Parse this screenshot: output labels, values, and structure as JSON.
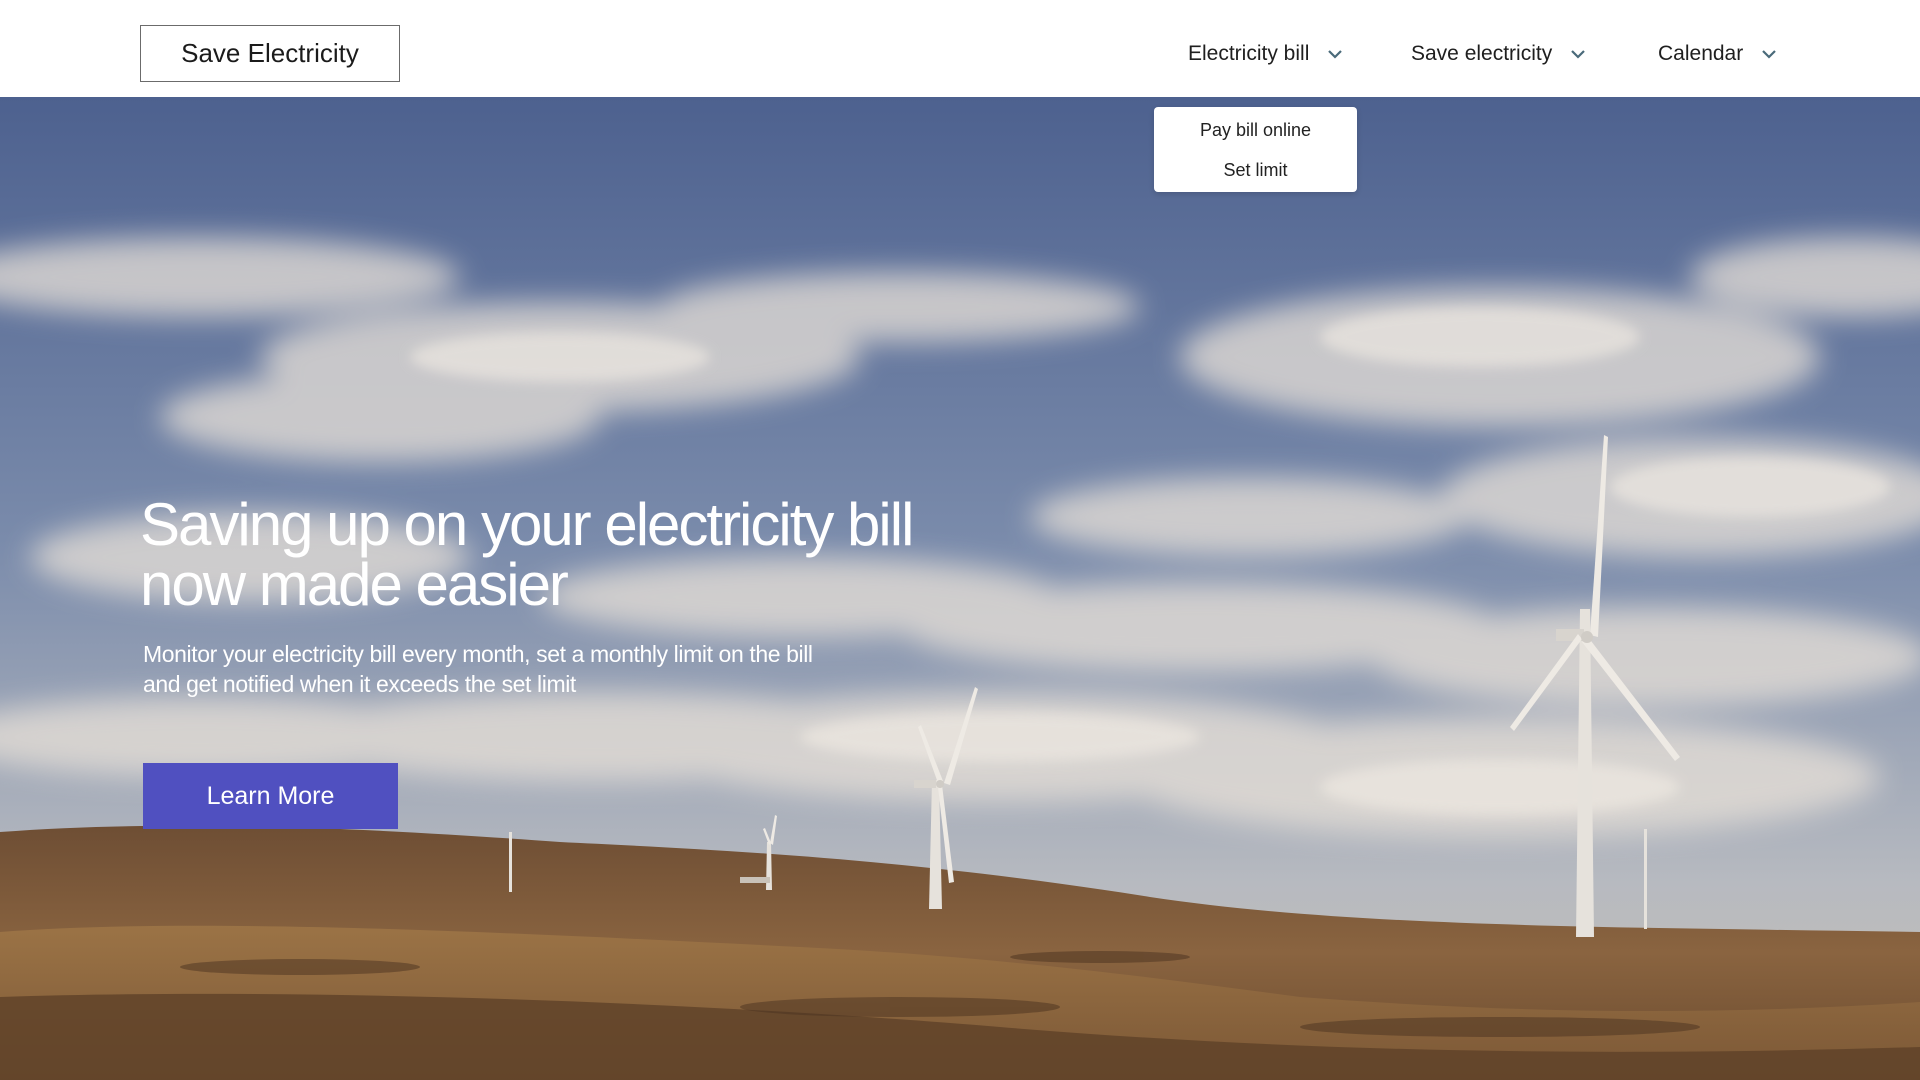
{
  "header": {
    "logo_text": "Save Electricity",
    "nav": [
      {
        "label": "Electricity bill",
        "icon": "chevron-down-icon"
      },
      {
        "label": "Save electricity",
        "icon": "chevron-down-icon"
      },
      {
        "label": "Calendar",
        "icon": "chevron-down-icon"
      }
    ]
  },
  "dropdown": {
    "items": [
      "Pay bill online",
      "Set limit"
    ]
  },
  "hero": {
    "headline_line1": "Saving up on your electricity bill",
    "headline_line2": "now made easier",
    "subtext_line1": "Monitor your electricity bill every month, set a monthly limit on the bill",
    "subtext_line2": "and get notified when it exceeds the set limit",
    "cta_label": "Learn More",
    "background_image": "wind-turbines-on-hills"
  },
  "colors": {
    "accent": "#5050c0",
    "sky_top": "#5a6e99",
    "sky_bottom": "#aab4c2",
    "hills": "#7a5a3a"
  }
}
